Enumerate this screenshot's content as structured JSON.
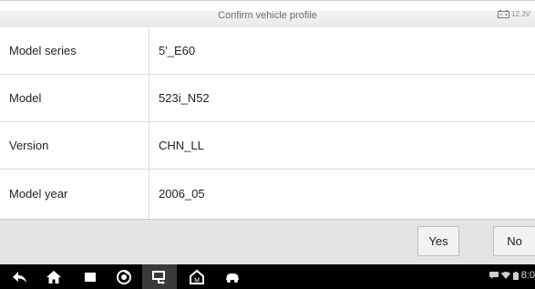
{
  "header": {
    "title": "Confirm vehicle profile",
    "battery_voltage": "12.3V"
  },
  "profile": {
    "rows": [
      {
        "label": "Model series",
        "value": "5'_E60"
      },
      {
        "label": "Model",
        "value": "523i_N52"
      },
      {
        "label": "Version",
        "value": "CHN_LL"
      },
      {
        "label": "Model year",
        "value": "2006_05"
      }
    ]
  },
  "footer": {
    "yes_label": "Yes",
    "no_label": "No"
  },
  "navbar": {
    "icons": [
      "back-icon",
      "home-icon",
      "recent-apps-icon",
      "browser-icon",
      "vci-connection-icon",
      "maxisys-home-icon",
      "car-icon"
    ],
    "status_icons": [
      "chat-icon",
      "wifi-icon",
      "battery-status-icon"
    ],
    "clock": "8:0"
  }
}
